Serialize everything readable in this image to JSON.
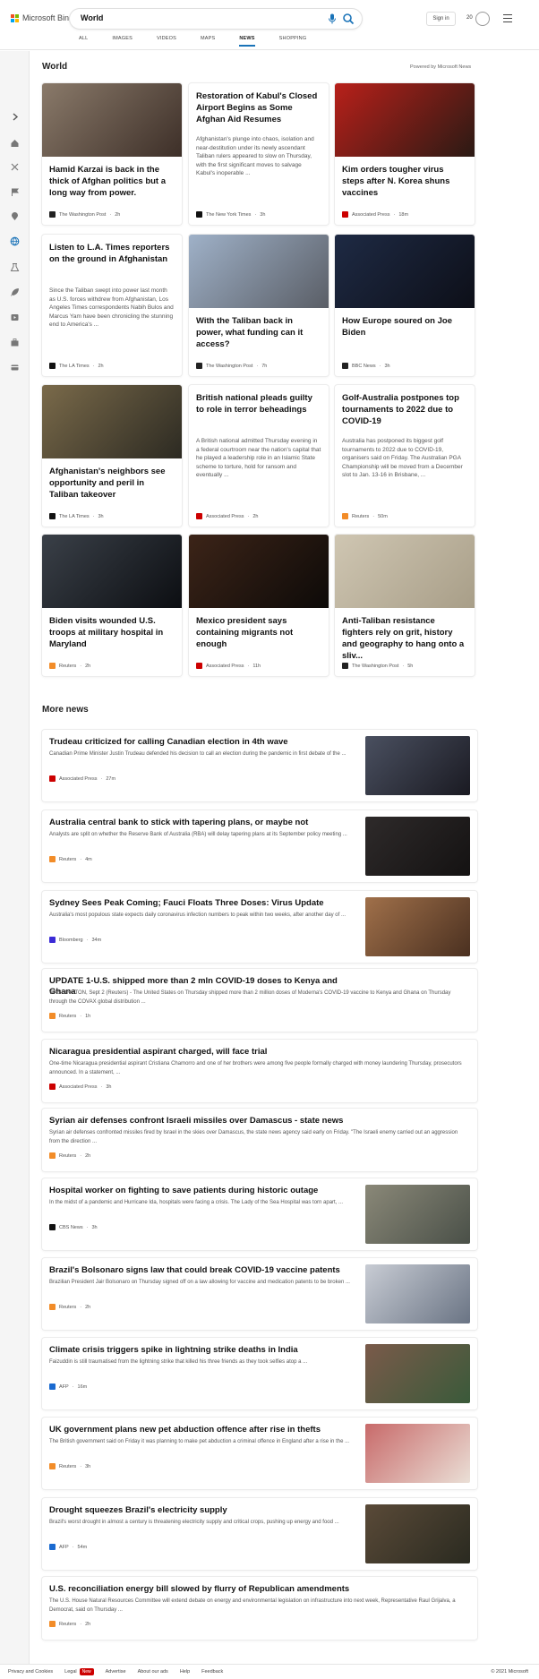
{
  "header": {
    "logo_text": "Microsoft Bing",
    "search_value": "World",
    "sign_in": "Sign in",
    "rewards_count": "20",
    "tabs": [
      {
        "label": "ALL"
      },
      {
        "label": "IMAGES"
      },
      {
        "label": "VIDEOS"
      },
      {
        "label": "MAPS"
      },
      {
        "label": "NEWS",
        "active": true
      },
      {
        "label": "SHOPPING"
      }
    ]
  },
  "sidebar": {
    "icons": [
      "chevron-right-icon",
      "home-icon",
      "sports-icon",
      "flag-icon",
      "location-icon",
      "globe-icon",
      "science-icon",
      "rocket-icon",
      "entertainment-icon",
      "business-icon",
      "money-icon"
    ]
  },
  "main": {
    "section_title": "World",
    "powered_by": "Powered by Microsoft News",
    "cards": [
      {
        "title": "Hamid Karzai is back in the thick of Afghan politics but a long way from power.",
        "snippet": "",
        "source": "The Washington Post",
        "age": "2h",
        "src_color": "#222",
        "img": [
          "#8a7a6a",
          "#3d2f28"
        ]
      },
      {
        "title": "Restoration of Kabul's Closed Airport Begins as Some Afghan Aid Resumes",
        "snippet": "Afghanistan's plunge into chaos, isolation and near-destitution under its newly ascendant Taliban rulers appeared to slow on Thursday, with the first significant moves to salvage Kabul's inoperable ...",
        "source": "The New York Times",
        "age": "3h",
        "src_color": "#111",
        "img": null
      },
      {
        "title": "Kim orders tougher virus steps after N. Korea shuns vaccines",
        "snippet": "",
        "source": "Associated Press",
        "age": "18m",
        "src_color": "#c00",
        "img": [
          "#b8201a",
          "#2a1a14"
        ]
      },
      {
        "title": "Listen to L.A. Times reporters on the ground in Afghanistan",
        "snippet": "Since the Taliban swept into power last month as U.S. forces withdrew from Afghanistan, Los Angeles Times correspondents Nabih Bulos and Marcus Yam have been chronicling the stunning end to America's ...",
        "source": "The LA Times",
        "age": "2h",
        "src_color": "#111",
        "img": null
      },
      {
        "title": "With the Taliban back in power, what funding can it access?",
        "snippet": "",
        "source": "The Washington Post",
        "age": "7h",
        "src_color": "#222",
        "img": [
          "#9fb1c8",
          "#5a5e66"
        ]
      },
      {
        "title": "How Europe soured on Joe Biden",
        "snippet": "",
        "source": "BBC News",
        "age": "3h",
        "src_color": "#222",
        "img": [
          "#1e2a44",
          "#0d0f18"
        ]
      },
      {
        "title": "Afghanistan's neighbors see opportunity and peril in Taliban takeover",
        "snippet": "",
        "source": "The LA Times",
        "age": "3h",
        "src_color": "#111",
        "img": [
          "#7a6a4a",
          "#2c2a22"
        ]
      },
      {
        "title": "British national pleads guilty to role in terror beheadings",
        "snippet": "A British national admitted Thursday evening in a federal courtroom near the nation's capital that he played a leadership role in an Islamic State scheme to torture, hold for ransom and eventually ...",
        "source": "Associated Press",
        "age": "2h",
        "src_color": "#c00",
        "img": null
      },
      {
        "title": "Golf-Australia postpones top tournaments to 2022 due to COVID-19",
        "snippet": "Australia has postponed its biggest golf tournaments to 2022 due to COVID-19, organisers said on Friday. The Australian PGA Championship will be moved from a December slot to Jan. 13-16 in Brisbane, ...",
        "source": "Reuters",
        "age": "50m",
        "src_color": "#f28c28",
        "img": null
      },
      {
        "title": "Biden visits wounded U.S. troops at military hospital in Maryland",
        "snippet": "",
        "source": "Reuters",
        "age": "2h",
        "src_color": "#f28c28",
        "img": [
          "#3a4048",
          "#0c0e12"
        ]
      },
      {
        "title": "Mexico president says containing migrants not enough",
        "snippet": "",
        "source": "Associated Press",
        "age": "11h",
        "src_color": "#c00",
        "img": [
          "#3c2418",
          "#0d0a08"
        ]
      },
      {
        "title": "Anti-Taliban resistance fighters rely on grit, history and geography to hang onto a sliv...",
        "snippet": "",
        "source": "The Washington Post",
        "age": "5h",
        "src_color": "#222",
        "img": [
          "#cfc6b2",
          "#a89e88"
        ]
      }
    ]
  },
  "more_news": {
    "title": "More news",
    "items": [
      {
        "title": "Trudeau criticized for calling Canadian election in 4th wave",
        "snippet": "Canadian Prime Minister Justin Trudeau defended his decision to call an election during the pandemic in first debate of the ...",
        "source": "Associated Press",
        "age": "27m",
        "src_color": "#c00",
        "img": [
          "#4a5060",
          "#1a1a22"
        ]
      },
      {
        "title": "Australia central bank to stick with tapering plans, or maybe not",
        "snippet": "Analysts are split on whether the Reserve Bank of Australia (RBA) will delay tapering plans at its September policy meeting ...",
        "source": "Reuters",
        "age": "4m",
        "src_color": "#f28c28",
        "img": [
          "#2e2a2a",
          "#141212"
        ]
      },
      {
        "title": "Sydney Sees Peak Coming; Fauci Floats Three Doses: Virus Update",
        "snippet": "Australia's most populous state expects daily coronavirus infection numbers to peak within two weeks, after another day of ...",
        "source": "Bloomberg",
        "age": "34m",
        "src_color": "#3b2bd6",
        "img": [
          "#a0704a",
          "#4a3020"
        ]
      },
      {
        "title": "UPDATE 1-U.S. shipped more than 2 mln COVID-19 doses to Kenya and Ghana",
        "snippet": "WASHINGTON, Sept 2 (Reuters) - The United States on Thursday shipped more than 2 million doses of Moderna's COVID-19 vaccine to Kenya and Ghana on Thursday through the COVAX global distribution ...",
        "source": "Reuters",
        "age": "1h",
        "src_color": "#f28c28",
        "img": null
      },
      {
        "title": "Nicaragua presidential aspirant charged, will face trial",
        "snippet": "One-time Nicaragua presidential aspirant Cristiana Chamorro and one of her brothers were among five people formally charged with money laundering Thursday, prosecutors announced. In a statement, ...",
        "source": "Associated Press",
        "age": "3h",
        "src_color": "#c00",
        "img": null
      },
      {
        "title": "Syrian air defenses confront Israeli missiles over Damascus - state news",
        "snippet": "Syrian air defenses confronted missiles fired by Israel in the skies over Damascus, the state news agency said early on Friday. \"The Israeli enemy carried out an aggression from the direction ...",
        "source": "Reuters",
        "age": "2h",
        "src_color": "#f28c28",
        "img": null
      },
      {
        "title": "Hospital worker on fighting to save patients during historic outage",
        "snippet": "In the midst of a pandemic and Hurricane Ida, hospitals were facing a crisis. The Lady of the Sea Hospital was torn apart, ...",
        "source": "CBS News",
        "age": "3h",
        "src_color": "#111",
        "img": [
          "#8a8878",
          "#4a5048"
        ]
      },
      {
        "title": "Brazil's Bolsonaro signs law that could break COVID-19 vaccine patents",
        "snippet": "Brazilian President Jair Bolsonaro on Thursday signed off on a law allowing for vaccine and medication patents to be broken ...",
        "source": "Reuters",
        "age": "2h",
        "src_color": "#f28c28",
        "img": [
          "#c8ccd4",
          "#6a7484"
        ]
      },
      {
        "title": "Climate crisis triggers spike in lightning strike deaths in India",
        "snippet": "Faizuddin is still traumatised from the lightning strike that killed his three friends as they took selfies atop a ...",
        "source": "AFP",
        "age": "16m",
        "src_color": "#1a6ad0",
        "img": [
          "#7a5a4a",
          "#3a5a3a"
        ]
      },
      {
        "title": "UK government plans new pet abduction offence after rise in thefts",
        "snippet": "The British government said on Friday it was planning to make pet abduction a criminal offence in England after a rise in the ...",
        "source": "Reuters",
        "age": "3h",
        "src_color": "#f28c28",
        "img": [
          "#c86a6a",
          "#eadfd6"
        ]
      },
      {
        "title": "Drought squeezes Brazil's electricity supply",
        "snippet": "Brazil's worst drought in almost a century is threatening electricity supply and critical crops, pushing up energy and food ...",
        "source": "AFP",
        "age": "54m",
        "src_color": "#1a6ad0",
        "img": [
          "#5a4a38",
          "#2a2a20"
        ]
      },
      {
        "title": "U.S. reconciliation energy bill slowed by flurry of Republican amendments",
        "snippet": "The U.S. House Natural Resources Committee will extend debate on energy and environmental legislation on infrastructure into next week, Representative Raul Grijalva, a Democrat, said on Thursday ...",
        "source": "Reuters",
        "age": "2h",
        "src_color": "#f28c28",
        "img": null
      }
    ]
  },
  "footer": {
    "links": [
      "Privacy and Cookies",
      "Legal",
      "Advertise",
      "About our ads",
      "Help",
      "Feedback"
    ],
    "new_badge": "New",
    "copyright": "© 2021 Microsoft"
  }
}
